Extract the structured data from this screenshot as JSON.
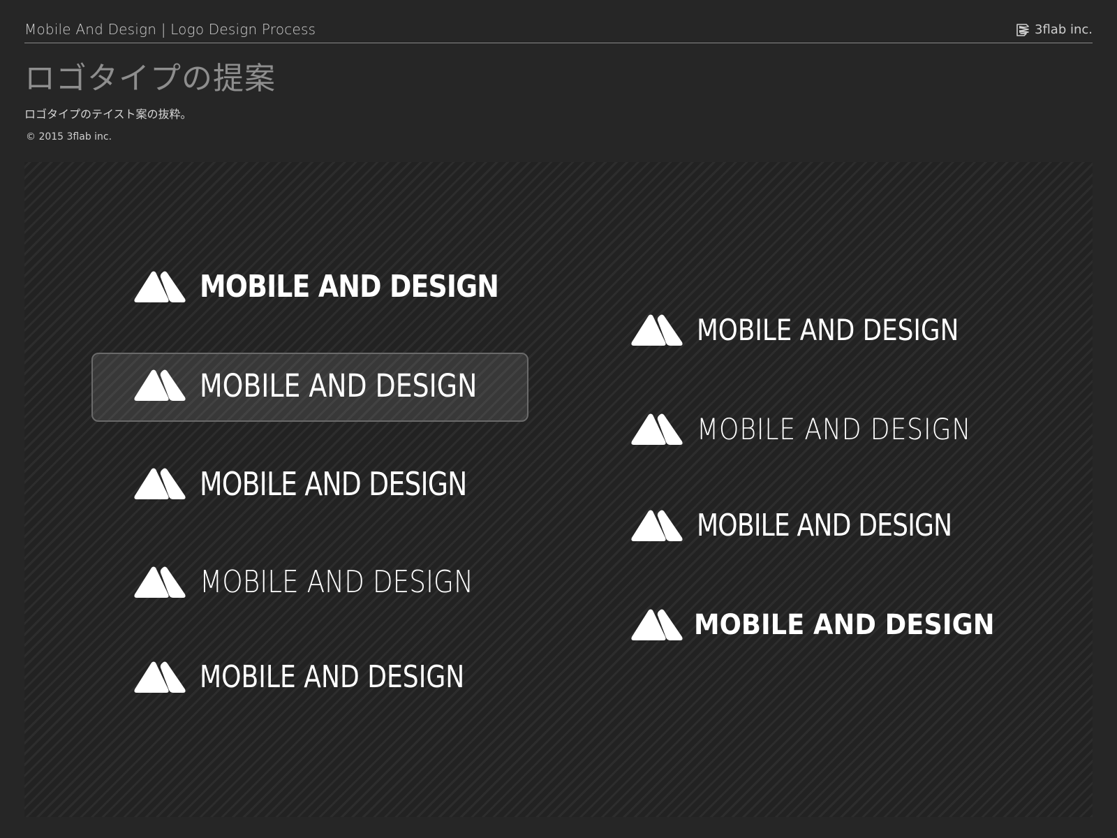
{
  "header": {
    "breadcrumb": "Mobile And Design | Logo Design Process",
    "brand_icon": "3flab-logo-icon",
    "brand_name": "3flab inc."
  },
  "page_title": "ロゴタイプの提案",
  "subtitle": "ロゴタイプのテイスト案の抜粋。",
  "copyright": "© 2015 3flab inc.",
  "logo_mark_icon": "mountain-triangles-icon",
  "left_column": [
    {
      "text": "MOBILE AND DESIGN"
    },
    {
      "text": "MOBILE AND DESIGN",
      "selected": true
    },
    {
      "text": "MOBILE AND DESIGN"
    },
    {
      "text": "MOBILE AND DESIGN"
    },
    {
      "text": "MOBILE AND DESIGN"
    }
  ],
  "right_column": [
    {
      "text": "MOBILE AND DESIGN"
    },
    {
      "text": "MOBILE AND DESIGN"
    },
    {
      "text": "MOBILE AND DESIGN"
    },
    {
      "text": "MOBILE AND DESIGN"
    }
  ],
  "colors": {
    "background": "#262626",
    "panel_stripe_light": "#2d2d2d",
    "panel_stripe_dark": "#222222",
    "logo": "#ffffff",
    "title_gray": "#8e8e8e",
    "text_light": "#cfcfcf"
  }
}
